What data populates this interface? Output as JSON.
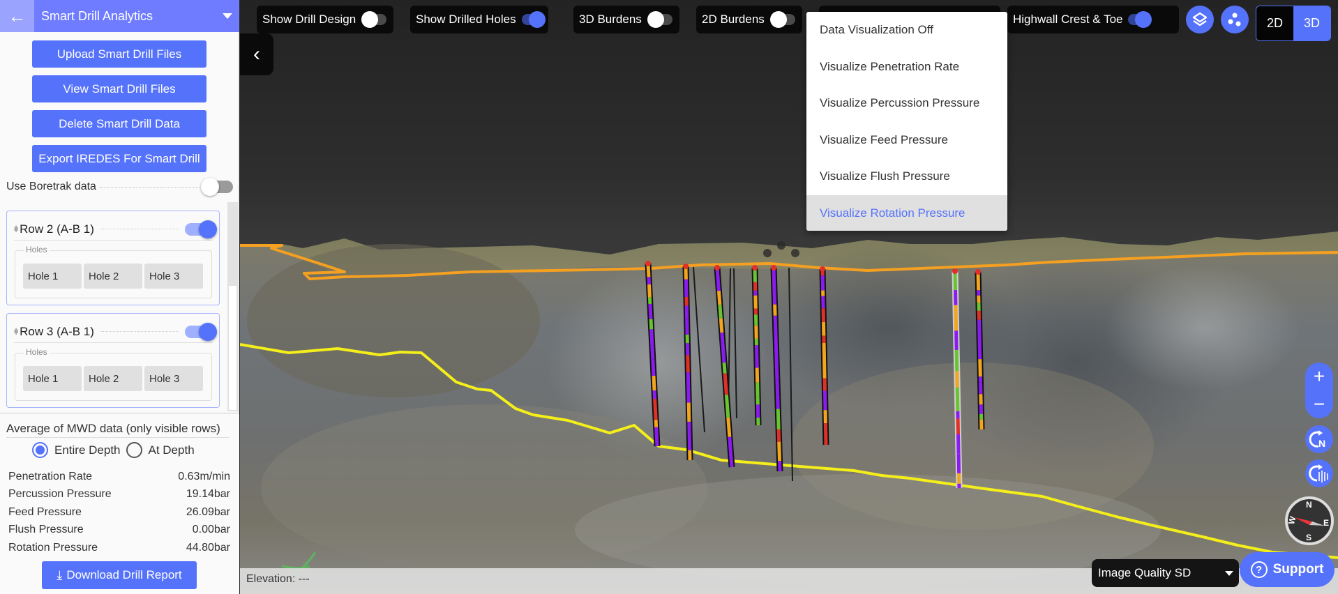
{
  "sidebar": {
    "title": "Smart Drill Analytics",
    "buttons": {
      "upload": "Upload Smart Drill Files",
      "view": "View Smart Drill Files",
      "delete": "Delete Smart Drill Data",
      "export": "Export IREDES For Smart Drill"
    },
    "boretrak": {
      "label": "Use Boretrak data",
      "enabled": false
    },
    "rows": [
      {
        "label": "Row 2 (A-B 1)",
        "visible": true,
        "holes_legend": "Holes",
        "holes": [
          "Hole 1",
          "Hole 2",
          "Hole 3"
        ]
      },
      {
        "label": "Row 3 (A-B 1)",
        "visible": true,
        "holes_legend": "Holes",
        "holes": [
          "Hole 1",
          "Hole 2",
          "Hole 3"
        ]
      }
    ],
    "mwd": {
      "title": "Average of MWD data (only visible rows)",
      "modes": [
        {
          "label": "Entire Depth",
          "selected": true
        },
        {
          "label": "At Depth",
          "selected": false
        }
      ],
      "stats": [
        {
          "name": "Penetration Rate",
          "value": "0.63m/min"
        },
        {
          "name": "Percussion Pressure",
          "value": "19.14bar"
        },
        {
          "name": "Feed Pressure",
          "value": "26.09bar"
        },
        {
          "name": "Flush Pressure",
          "value": "0.00bar"
        },
        {
          "name": "Rotation Pressure",
          "value": "44.80bar"
        }
      ],
      "download_label": "Download Drill Report"
    }
  },
  "toolbar": {
    "toggles": [
      {
        "label": "Show Drill Design",
        "on": false
      },
      {
        "label": "Show Drilled Holes",
        "on": true
      },
      {
        "label": "3D Burdens",
        "on": false
      },
      {
        "label": "2D Burdens",
        "on": false
      },
      {
        "label": "Highwall Crest & Toe",
        "on": true
      }
    ],
    "layers_icon": "layers-icon",
    "points_icon": "scatter-points-icon",
    "view_modes": [
      "2D",
      "3D"
    ],
    "active_view_mode": "3D"
  },
  "viz_menu": {
    "items": [
      "Data Visualization Off",
      "Visualize Penetration Rate",
      "Visualize Percussion Pressure",
      "Visualize Feed Pressure",
      "Visualize Flush Pressure",
      "Visualize Rotation Pressure"
    ],
    "selected": "Visualize Rotation Pressure"
  },
  "map_controls": {
    "zoom_in": "+",
    "zoom_out": "−",
    "compass_labels": {
      "n": "N",
      "e": "E",
      "s": "S",
      "w": "W"
    }
  },
  "footer": {
    "elevation": "Elevation: ---",
    "image_quality": "Image Quality SD",
    "support": "Support"
  },
  "colors": {
    "accent": "#5572fb",
    "header": "#6f7cff",
    "crest_line": "#f5a020",
    "toe_line": "#f4ef1a",
    "segment_purple": "#8a1cf0",
    "segment_orange": "#f2a51e",
    "segment_green": "#6ac431",
    "segment_red": "#e0302a"
  }
}
